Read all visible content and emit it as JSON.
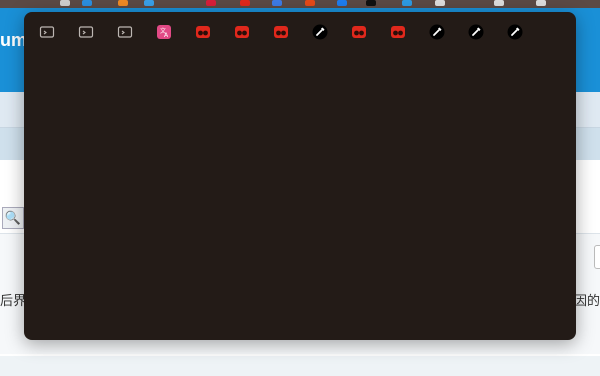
{
  "background_page": {
    "logo_fragment": "um",
    "search_icon": "search-icon",
    "text_left_fragment": "后界",
    "text_right_fragment": "原因的"
  },
  "bookmarks_overflow": {
    "items": [
      {
        "icon": "folder-icon",
        "label": ""
      },
      {
        "icon": "folder-icon",
        "label": ""
      },
      {
        "icon": "folder-icon",
        "label": ""
      },
      {
        "icon": "translate-icon",
        "label": ""
      },
      {
        "icon": "red-extension-icon",
        "label": ""
      },
      {
        "icon": "red-extension-icon",
        "label": ""
      },
      {
        "icon": "red-extension-icon",
        "label": ""
      },
      {
        "icon": "tool-icon",
        "label": ""
      },
      {
        "icon": "red-extension-icon",
        "label": ""
      },
      {
        "icon": "red-extension-icon",
        "label": ""
      },
      {
        "icon": "tool-icon",
        "label": ""
      },
      {
        "icon": "tool-icon",
        "label": ""
      },
      {
        "icon": "tool-icon",
        "label": ""
      }
    ]
  },
  "colors": {
    "popup_bg": "#231b17",
    "header_blue": "#1a90d7",
    "red_icon": "#e0281c",
    "translate_pink": "#e24a86"
  }
}
